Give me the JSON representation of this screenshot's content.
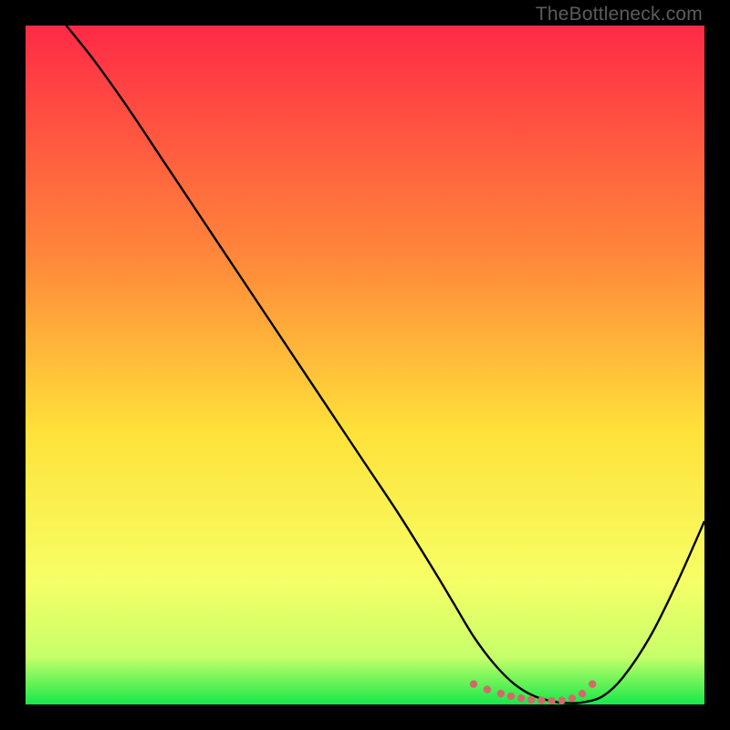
{
  "watermark": "TheBottleneck.com",
  "chart_data": {
    "type": "line",
    "title": "",
    "xlabel": "",
    "ylabel": "",
    "xlim": [
      0,
      100
    ],
    "ylim": [
      0,
      100
    ],
    "gradient_stops": [
      {
        "offset": 0.0,
        "color": "#ff2a46"
      },
      {
        "offset": 0.35,
        "color": "#ff8a3a"
      },
      {
        "offset": 0.6,
        "color": "#ffe23a"
      },
      {
        "offset": 0.82,
        "color": "#f6ff66"
      },
      {
        "offset": 0.93,
        "color": "#c6ff6a"
      },
      {
        "offset": 1.0,
        "color": "#17e84a"
      }
    ],
    "series": [
      {
        "name": "bottleneck-curve",
        "x": [
          6,
          10,
          15,
          20,
          25,
          30,
          35,
          40,
          45,
          50,
          55,
          60,
          63,
          66,
          69,
          72,
          75,
          78,
          80,
          82,
          85,
          88,
          92,
          96,
          100
        ],
        "y": [
          100,
          95,
          88,
          80.5,
          73,
          65.5,
          58,
          50.5,
          43,
          35.5,
          28,
          20,
          15,
          10,
          6,
          3,
          1.2,
          0.4,
          0.2,
          0.3,
          1.2,
          4,
          10,
          18,
          27
        ]
      }
    ],
    "markers": {
      "name": "valley-dots",
      "color": "#d16a6a",
      "x": [
        66,
        68,
        70,
        71.5,
        73,
        74.5,
        76,
        77.5,
        79,
        80.5,
        82,
        83.5
      ],
      "y": [
        3.0,
        2.2,
        1.6,
        1.2,
        0.9,
        0.7,
        0.6,
        0.55,
        0.6,
        0.9,
        1.6,
        3.0
      ]
    }
  }
}
